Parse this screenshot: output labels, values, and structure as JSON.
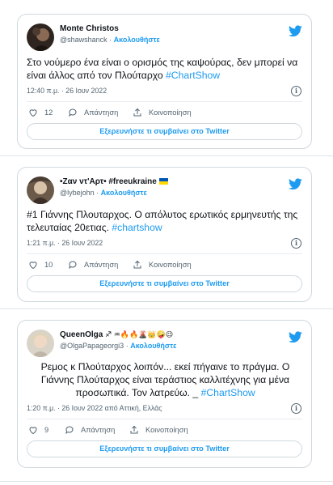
{
  "colors": {
    "accent": "#1d9bf0",
    "text": "#0f1419",
    "muted": "#536471",
    "border": "#cfd9de"
  },
  "tweets": [
    {
      "name": "Monte Christos",
      "handle": "@shawshanck",
      "follow_label": "Ακολουθήστε",
      "text_parts": [
        {
          "t": "Στο νούμερο ένα είναι ο ορισμός της καψούρας, δεν μπορεί να είναι άλλος από τον Πλούταρχο   "
        },
        {
          "t": "#ChartShow",
          "tag": true
        }
      ],
      "time": "12:40 π.μ. · 26 Ιουν 2022",
      "likes": "12",
      "reply_label": "Απάντηση",
      "share_label": "Κοινοποίηση",
      "cta_label": "Εξερευνήστε τι συμβαίνει στο Twitter",
      "icons": [
        "twitter-bird-icon",
        "info-icon",
        "heart-icon",
        "reply-icon",
        "share-icon"
      ]
    },
    {
      "name": "•Ζαν ντ'Αρτ• #freeukraine",
      "handle": "@lybejohn",
      "follow_label": "Ακολουθήστε",
      "text_parts": [
        {
          "t": "#1 Γιάννης Πλουταρχος. Ο απόλυτος ερωτικός ερμηνευτής της τελευταίας 20ετιας. "
        },
        {
          "t": "#chartshow",
          "tag": true
        }
      ],
      "time": "1:21 π.μ. · 26 Ιουν 2022",
      "likes": "10",
      "reply_label": "Απάντηση",
      "share_label": "Κοινοποίηση",
      "cta_label": "Εξερευνήστε τι συμβαίνει στο Twitter",
      "icons": [
        "twitter-bird-icon",
        "ukraine-flag-icon",
        "info-icon",
        "heart-icon",
        "reply-icon",
        "share-icon"
      ]
    },
    {
      "name": "QueenOlga",
      "name_emoji": "♐ ♒🔥🔥🌋👑🤪😉",
      "handle": "@OlgaPapageorgi3",
      "follow_label": "Ακολουθήστε",
      "text_parts": [
        {
          "t": "Ρεμος κ Πλούταρχος  λοιπόν... εκεί  πήγαινε το πράγμα. Ο Γιάννης Πλούταρχος είναι  τεράστιος καλλιτέχνης για μένα  προσωπικά. Τον λατρεύω. _ "
        },
        {
          "t": "#ChartShow",
          "tag": true
        }
      ],
      "time": "1:20 π.μ. · 26 Ιουν 2022 από Αττική, Ελλάς",
      "likes": "9",
      "reply_label": "Απάντηση",
      "share_label": "Κοινοποίηση",
      "cta_label": "Εξερευνήστε τι συμβαίνει στο Twitter",
      "icons": [
        "twitter-bird-icon",
        "info-icon",
        "heart-icon",
        "reply-icon",
        "share-icon"
      ]
    }
  ]
}
